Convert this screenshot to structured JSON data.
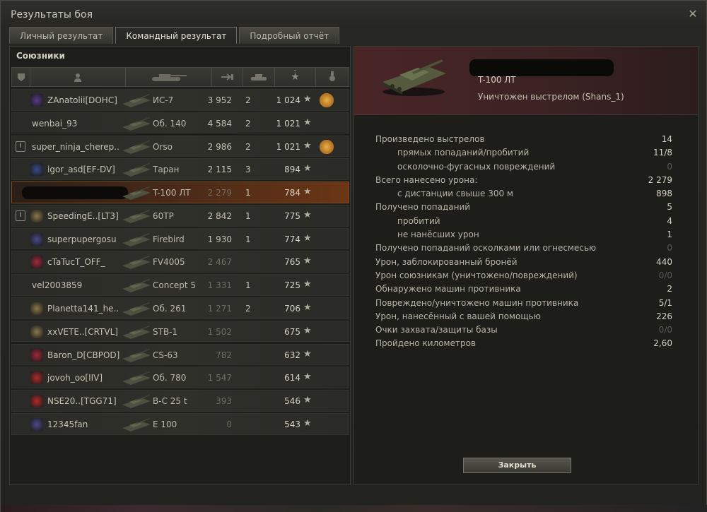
{
  "window": {
    "title": "Результаты боя"
  },
  "tabs": [
    {
      "label": "Личный результат",
      "active": false
    },
    {
      "label": "Командный результат",
      "active": true
    },
    {
      "label": "Подробный отчёт",
      "active": false
    }
  ],
  "team": {
    "title": "Союзники",
    "columns": [
      "platoon-icon",
      "player-icon",
      "tank-icon",
      "damage-icon",
      "kills-icon",
      "xp-star-icon",
      "medal-icon"
    ],
    "rows": [
      {
        "platoon": "",
        "player": "ZAnatolii[DOHC]",
        "vehicle": "ИС-7",
        "damage": "3 952",
        "kills": "2",
        "xp": "1 024",
        "medal": true,
        "badge_color": "#5a3a8a"
      },
      {
        "platoon": "",
        "player": "wenbai_93",
        "vehicle": "Об. 140",
        "damage": "4 584",
        "kills": "2",
        "xp": "1 021",
        "medal": false,
        "badge_color": ""
      },
      {
        "platoon": "I",
        "player": "super_ninja_cherep..",
        "vehicle": "Orso",
        "damage": "2 986",
        "kills": "2",
        "xp": "1 021",
        "medal": true,
        "badge_color": ""
      },
      {
        "platoon": "",
        "player": "igor_asd[EF-DV]",
        "vehicle": "Таран",
        "damage": "2 115",
        "kills": "3",
        "xp": "894",
        "medal": false,
        "badge_color": "#3a4a8a"
      },
      {
        "platoon": "",
        "player": "",
        "vehicle": "T-100 ЛТ",
        "damage": "2 279",
        "kills": "1",
        "xp": "784",
        "medal": false,
        "badge_color": "",
        "self": true
      },
      {
        "platoon": "I",
        "player": "SpeedingE..[LT3]",
        "vehicle": "60TP",
        "damage": "2 842",
        "kills": "1",
        "xp": "775",
        "medal": false,
        "badge_color": "#8a7a4a"
      },
      {
        "platoon": "",
        "player": "superpupergosu",
        "vehicle": "Firebird",
        "damage": "1 930",
        "kills": "1",
        "xp": "774",
        "medal": false,
        "badge_color": "#4a4a8a"
      },
      {
        "platoon": "",
        "player": "cTaTucT_OFF_",
        "vehicle": "FV4005",
        "damage": "2 467",
        "kills": "",
        "xp": "765",
        "medal": false,
        "badge_color": "#a02a3a"
      },
      {
        "platoon": "",
        "player": "vel2003859",
        "vehicle": "Concept 5",
        "damage": "1 331",
        "kills": "1",
        "xp": "725",
        "medal": false,
        "badge_color": ""
      },
      {
        "platoon": "",
        "player": "Planetta141_he..",
        "vehicle": "Об. 261",
        "damage": "1 271",
        "kills": "2",
        "xp": "706",
        "medal": false,
        "badge_color": "#8a7a4a"
      },
      {
        "platoon": "",
        "player": "xxVETE..[CRTVL]",
        "vehicle": "STB-1",
        "damage": "1 502",
        "kills": "",
        "xp": "675",
        "medal": false,
        "badge_color": "#8a7a4a"
      },
      {
        "platoon": "",
        "player": "Baron_D[CBPOD]",
        "vehicle": "CS-63",
        "damage": "782",
        "kills": "",
        "xp": "632",
        "medal": false,
        "badge_color": "#a02a3a"
      },
      {
        "platoon": "",
        "player": "jovoh_oo[IIV]",
        "vehicle": "Об. 780",
        "damage": "1 547",
        "kills": "",
        "xp": "614",
        "medal": false,
        "badge_color": "#b02a2a"
      },
      {
        "platoon": "",
        "player": "NSE20..[TGG71]",
        "vehicle": "B-C 25 t",
        "damage": "393",
        "kills": "",
        "xp": "546",
        "medal": false,
        "badge_color": "#b02a2a"
      },
      {
        "platoon": "",
        "player": "12345fan",
        "vehicle": "E 100",
        "damage": "0",
        "kills": "",
        "xp": "543",
        "medal": false,
        "badge_color": "#4a4a8a"
      }
    ]
  },
  "detail": {
    "vehicle": "T-100 ЛТ",
    "death": "Уничтожен выстрелом (Shans_1)",
    "stats": [
      {
        "label": "Произведено выстрелов",
        "value": "14",
        "sub": false,
        "dim": false
      },
      {
        "label": "прямых попаданий/пробитий",
        "value": "11/8",
        "sub": true,
        "dim": false
      },
      {
        "label": "осколочно-фугасных повреждений",
        "value": "0",
        "sub": true,
        "dim": true
      },
      {
        "label": "Всего нанесено урона:",
        "value": "2 279",
        "sub": false,
        "dim": false
      },
      {
        "label": "с дистанции свыше 300 м",
        "value": "898",
        "sub": true,
        "dim": false
      },
      {
        "label": "Получено попаданий",
        "value": "5",
        "sub": false,
        "dim": false
      },
      {
        "label": "пробитий",
        "value": "4",
        "sub": true,
        "dim": false
      },
      {
        "label": "не нанёсших урон",
        "value": "1",
        "sub": true,
        "dim": false
      },
      {
        "label": "Получено попаданий осколками или огнесмесью",
        "value": "0",
        "sub": false,
        "dim": true
      },
      {
        "label": "Урон, заблокированный бронёй",
        "value": "440",
        "sub": false,
        "dim": false
      },
      {
        "label": "Урон союзникам (уничтожено/повреждений)",
        "value": "0/0",
        "sub": false,
        "dim": true
      },
      {
        "label": "Обнаружено машин противника",
        "value": "2",
        "sub": false,
        "dim": false
      },
      {
        "label": "Повреждено/уничтожено машин противника",
        "value": "5/1",
        "sub": false,
        "dim": false
      },
      {
        "label": "Урон, нанесённый с вашей помощью",
        "value": "226",
        "sub": false,
        "dim": false
      },
      {
        "label": "Очки захвата/защиты базы",
        "value": "0/0",
        "sub": false,
        "dim": true
      },
      {
        "label": "Пройдено километров",
        "value": "2,60",
        "sub": false,
        "dim": false
      }
    ],
    "close_label": "Закрыть"
  },
  "colors": {
    "accent": "#e8b14a",
    "self_row": "#6b3616",
    "card_bg": "#4a2526"
  }
}
